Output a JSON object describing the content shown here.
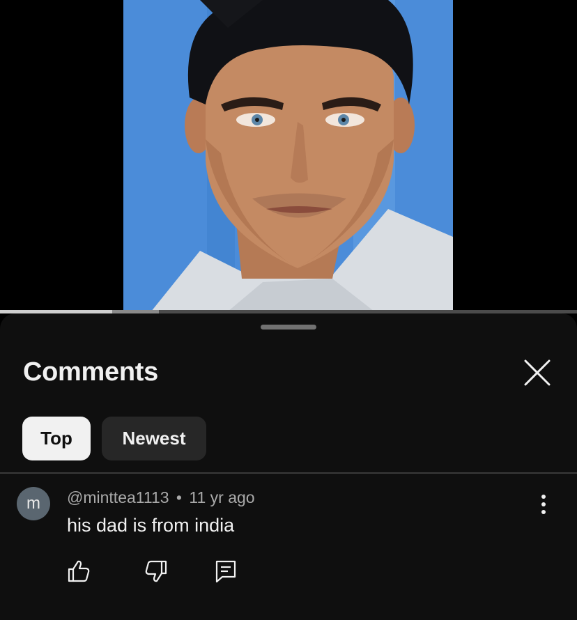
{
  "video": {
    "progress_fraction": 0.195,
    "buffered_fraction": 0.275
  },
  "comments_sheet": {
    "title": "Comments",
    "close_icon": "close-icon",
    "sort_chips": [
      {
        "label": "Top",
        "selected": true
      },
      {
        "label": "Newest",
        "selected": false
      }
    ],
    "comments": [
      {
        "avatar_initial": "m",
        "author": "@minttea1113",
        "separator": "•",
        "time": "11 yr ago",
        "text": "his dad is from india",
        "actions": [
          "like-icon",
          "dislike-icon",
          "reply-icon"
        ]
      }
    ]
  },
  "colors": {
    "sheet_background": "#0f0f0f",
    "chip_selected": "#f1f1f1",
    "chip_unselected": "#272727",
    "avatar": "#5a6670",
    "text_primary": "#f1f1f1",
    "text_secondary": "#aaaaaa"
  }
}
